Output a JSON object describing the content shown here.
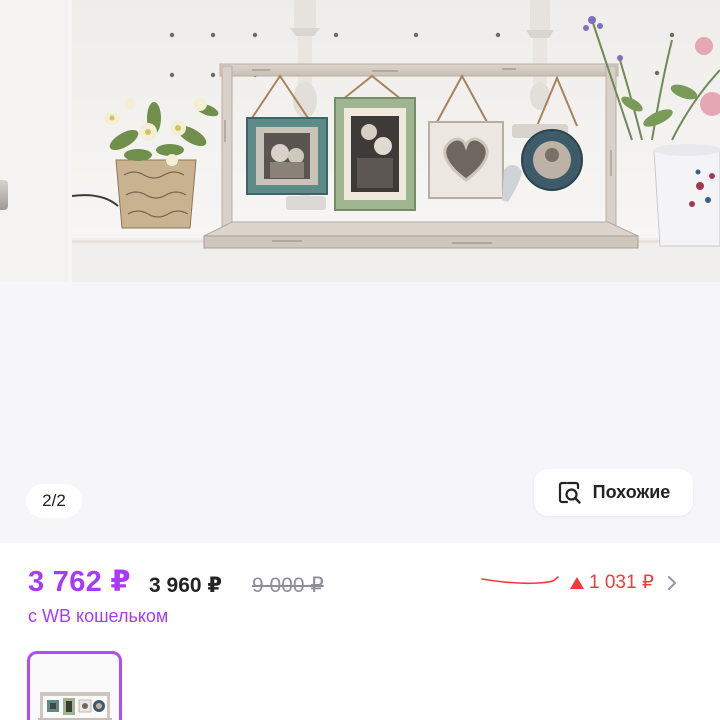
{
  "gallery": {
    "counter": "2/2",
    "similar_button": {
      "label": "Похожие",
      "icon": "search-image-icon"
    }
  },
  "price": {
    "wallet_price": "3 762 ₽",
    "regular_price": "3 960 ₽",
    "old_price": "9 000 ₽",
    "wallet_note": "с WB кошельком",
    "change": {
      "value": "1 031 ₽",
      "icon": "triangle-up-icon",
      "detail_icon": "chevron-right-icon"
    }
  },
  "colors": {
    "accent": "#a73afd",
    "price_up": "#f43a3a",
    "text_primary": "#242424",
    "text_muted": "#8e8e96",
    "thumb_border": "#b24cf5"
  }
}
